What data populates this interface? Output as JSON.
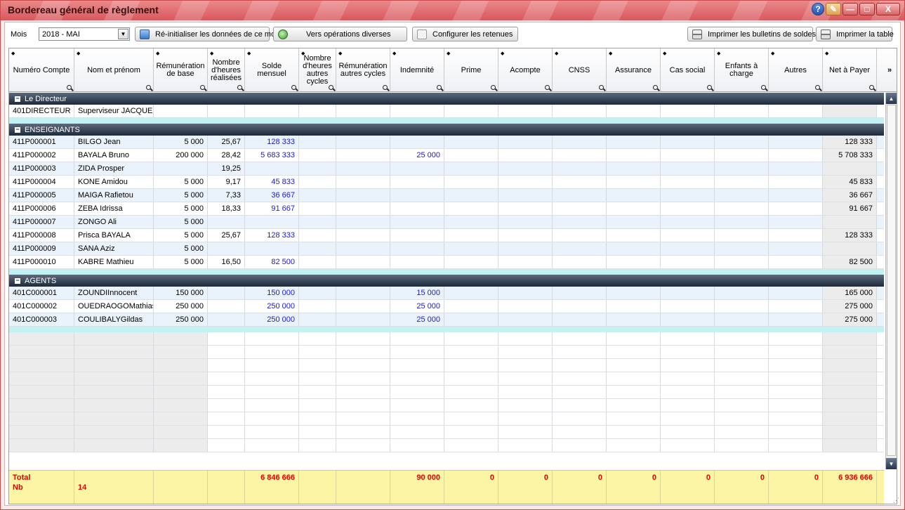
{
  "window": {
    "title": "Bordereau général de règlement",
    "controls": {
      "help": "?",
      "minimize": "—",
      "maximize": "□",
      "close": "X"
    }
  },
  "toolbar": {
    "mois_label": "Mois",
    "mois_value": "2018 - MAI",
    "reinit_label": "Ré-initialiser les données de ce mois",
    "ops_label": "Vers opérations diverses",
    "config_label": "Configurer les retenues",
    "print_bulletins_label": "Imprimer les bulletins de soldes",
    "print_table_label": "Imprimer la table"
  },
  "columns": [
    {
      "key": "numero",
      "label": "Numéro Compte"
    },
    {
      "key": "nom",
      "label": "Nom et prénom"
    },
    {
      "key": "remun",
      "label": "Rémunération de base"
    },
    {
      "key": "heures",
      "label": "Nombre d'heures réalisées"
    },
    {
      "key": "solde",
      "label": "Solde mensuel"
    },
    {
      "key": "heures_autres",
      "label": "Nombre d'heures autres cycles"
    },
    {
      "key": "remun_autres",
      "label": "Rémunération autres cycles"
    },
    {
      "key": "indemnite",
      "label": "Indemnité"
    },
    {
      "key": "prime",
      "label": "Prime"
    },
    {
      "key": "acompte",
      "label": "Acompte"
    },
    {
      "key": "cnss",
      "label": "CNSS"
    },
    {
      "key": "assurance",
      "label": "Assurance"
    },
    {
      "key": "cas_social",
      "label": "Cas social"
    },
    {
      "key": "enfants",
      "label": "Enfants à charge"
    },
    {
      "key": "autres",
      "label": "Autres"
    },
    {
      "key": "net",
      "label": "Net à Payer"
    }
  ],
  "groups": [
    {
      "name": "Le Directeur",
      "rows": [
        {
          "numero": "401DIRECTEUR",
          "nom": "Superviseur JACQUES",
          "remun": "",
          "heures": "",
          "solde": "",
          "indemnite": "",
          "net": ""
        }
      ]
    },
    {
      "name": "ENSEIGNANTS",
      "rows": [
        {
          "numero": "411P000001",
          "nom": "BILGO Jean",
          "remun": "5 000",
          "heures": "25,67",
          "solde": "128 333",
          "indemnite": "",
          "net": "128 333"
        },
        {
          "numero": "411P000002",
          "nom": "BAYALA Bruno",
          "remun": "200 000",
          "heures": "28,42",
          "solde": "5 683 333",
          "indemnite": "25 000",
          "net": "5 708 333"
        },
        {
          "numero": "411P000003",
          "nom": "ZIDA Prosper",
          "remun": "",
          "heures": "19,25",
          "solde": "",
          "indemnite": "",
          "net": ""
        },
        {
          "numero": "411P000004",
          "nom": "KONE Amidou",
          "remun": "5 000",
          "heures": "9,17",
          "solde": "45 833",
          "indemnite": "",
          "net": "45 833"
        },
        {
          "numero": "411P000005",
          "nom": "MAIGA Rafietou",
          "remun": "5 000",
          "heures": "7,33",
          "solde": "36 667",
          "indemnite": "",
          "net": "36 667"
        },
        {
          "numero": "411P000006",
          "nom": "ZEBA Idrissa",
          "remun": "5 000",
          "heures": "18,33",
          "solde": "91 667",
          "indemnite": "",
          "net": "91 667"
        },
        {
          "numero": "411P000007",
          "nom": "ZONGO Ali",
          "remun": "5 000",
          "heures": "",
          "solde": "",
          "indemnite": "",
          "net": ""
        },
        {
          "numero": "411P000008",
          "nom": "Prisca BAYALA",
          "remun": "5 000",
          "heures": "25,67",
          "solde": "128 333",
          "indemnite": "",
          "net": "128 333"
        },
        {
          "numero": "411P000009",
          "nom": "SANA Aziz",
          "remun": "5 000",
          "heures": "",
          "solde": "",
          "indemnite": "",
          "net": ""
        },
        {
          "numero": "411P000010",
          "nom": "KABRE Mathieu",
          "remun": "5 000",
          "heures": "16,50",
          "solde": "82 500",
          "indemnite": "",
          "net": "82 500"
        }
      ]
    },
    {
      "name": "AGENTS",
      "rows": [
        {
          "numero": "401C000001",
          "nom": "ZOUNDIInnocent",
          "remun": "150 000",
          "heures": "",
          "solde": "150 000",
          "indemnite": "15 000",
          "net": "165 000"
        },
        {
          "numero": "401C000002",
          "nom": "OUEDRAOGOMathias",
          "remun": "250 000",
          "heures": "",
          "solde": "250 000",
          "indemnite": "25 000",
          "net": "275 000"
        },
        {
          "numero": "401C000003",
          "nom": "COULIBALYGildas",
          "remun": "250 000",
          "heures": "",
          "solde": "250 000",
          "indemnite": "25 000",
          "net": "275 000"
        }
      ]
    }
  ],
  "footer": {
    "total_label": "Total",
    "nb_label": "Nb",
    "nb_value": "14",
    "solde": "6 846 666",
    "indemnite": "90 000",
    "prime": "0",
    "acompte": "0",
    "cnss": "0",
    "assurance": "0",
    "cas_social": "0",
    "enfants": "0",
    "autres": "0",
    "net": "6 936 666"
  },
  "colors": {
    "title_bar": "#d9575c",
    "group_header": "#1d2a3c",
    "blue_value": "#1a1ad6",
    "footer_bg": "#fbf5a5",
    "footer_text": "#e10000"
  }
}
